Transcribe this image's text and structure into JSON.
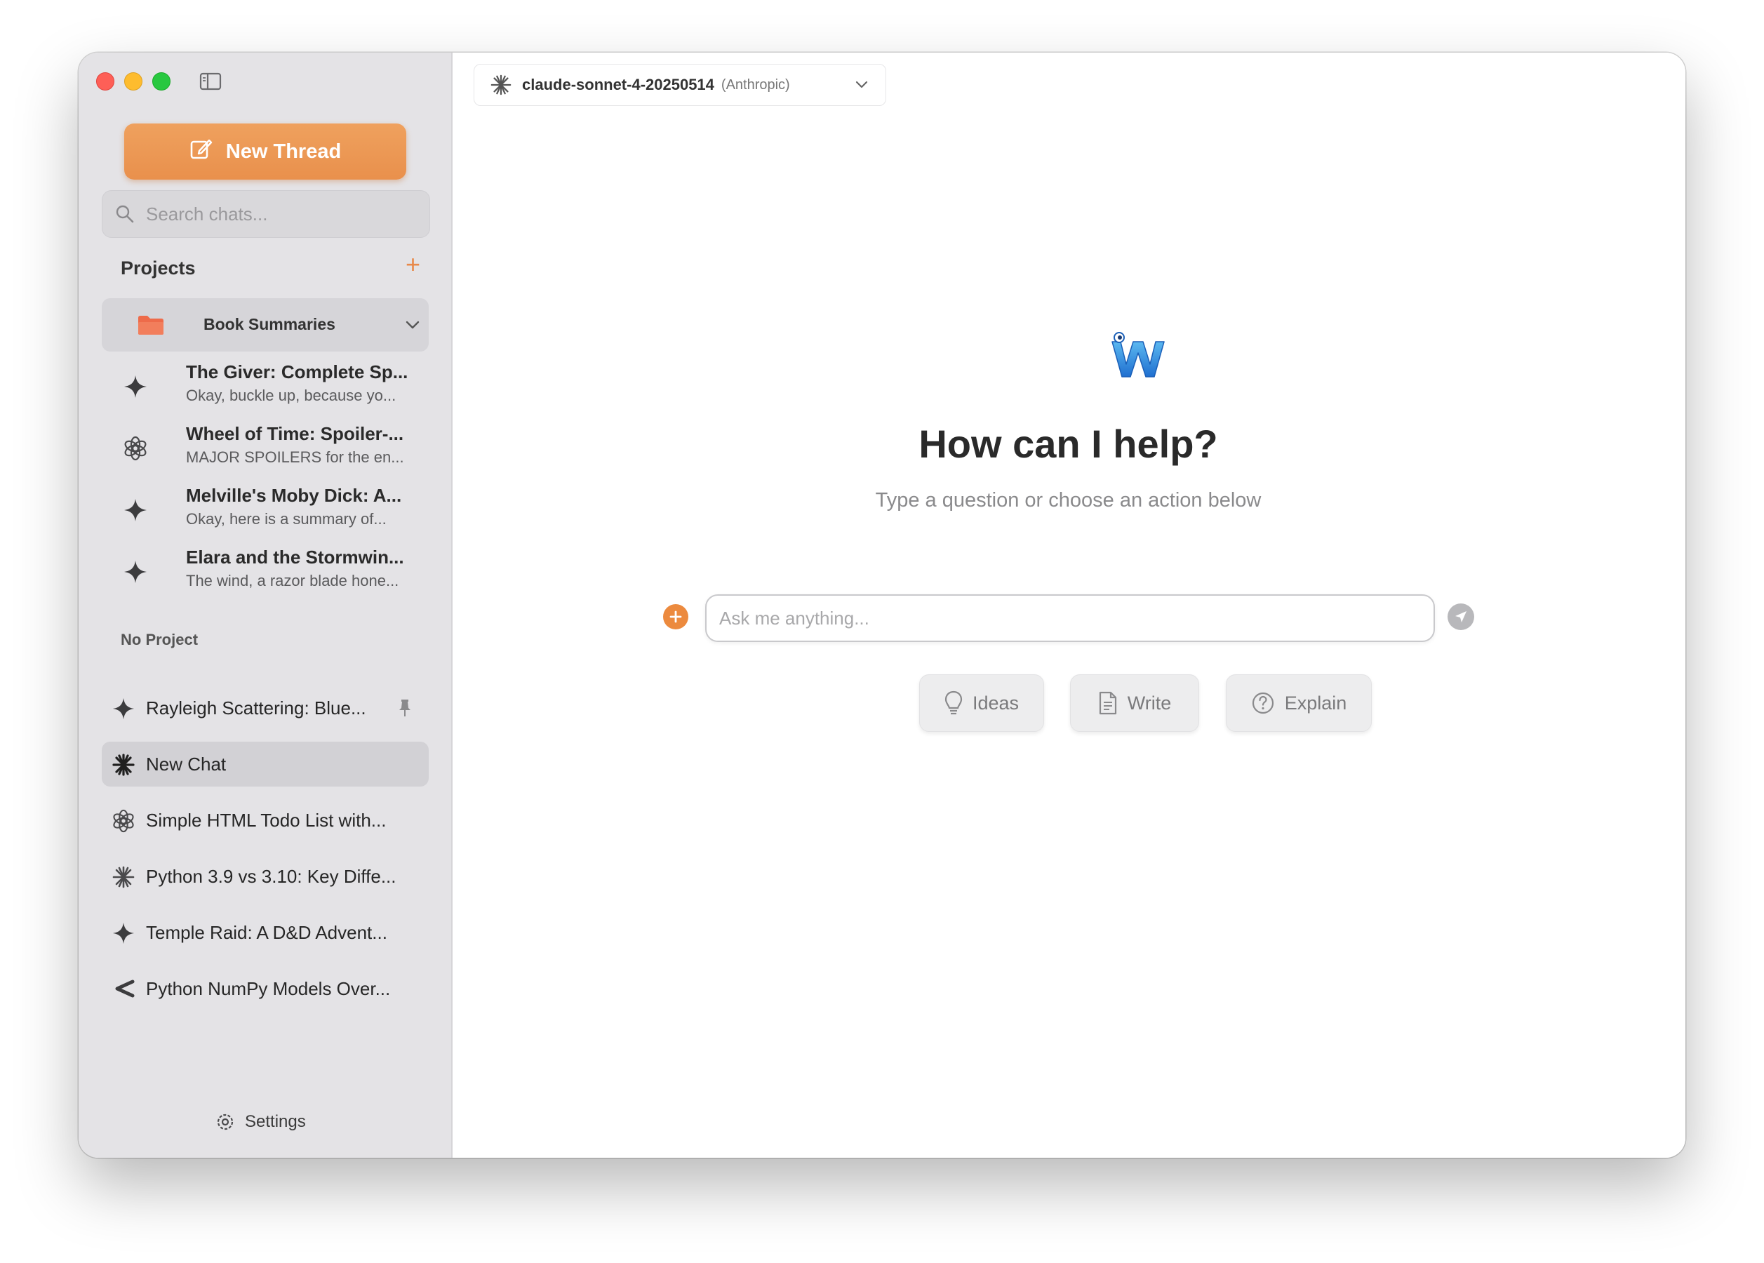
{
  "sidebar": {
    "new_thread_label": "New Thread",
    "search_placeholder": "Search chats...",
    "projects_title": "Projects",
    "projects_add": "+",
    "project_folder": {
      "name": "Book Summaries",
      "chats": [
        {
          "icon": "gemini-sparkle-icon",
          "title": "The Giver: Complete Sp...",
          "preview": "Okay, buckle up, because yo..."
        },
        {
          "icon": "openai-icon",
          "title": "Wheel of Time: Spoiler-...",
          "preview": "MAJOR SPOILERS for the en..."
        },
        {
          "icon": "gemini-sparkle-icon",
          "title": "Melville's Moby Dick: A...",
          "preview": "Okay, here is a summary of..."
        },
        {
          "icon": "gemini-sparkle-icon",
          "title": "Elara and the Stormwin...",
          "preview": "The wind, a razor blade hone..."
        }
      ]
    },
    "no_project_title": "No Project",
    "chats": [
      {
        "icon": "gemini-sparkle-icon",
        "label": "Rayleigh Scattering: Blue...",
        "pinned": true
      },
      {
        "icon": "anthropic-asterisk-icon",
        "label": "New Chat",
        "selected": true
      },
      {
        "icon": "openai-icon",
        "label": "Simple HTML Todo List with..."
      },
      {
        "icon": "anthropic-asterisk-icon",
        "label": "Python 3.9 vs 3.10: Key Diffe..."
      },
      {
        "icon": "gemini-sparkle-icon",
        "label": "Temple Raid: A D&D Advent..."
      },
      {
        "icon": "cohere-icon",
        "label": "Python NumPy Models Over..."
      }
    ],
    "settings_label": "Settings"
  },
  "main": {
    "model_name": "claude-sonnet-4-20250514",
    "model_provider": "(Anthropic)",
    "hero_title": "How can I help?",
    "hero_subtitle": "Type a question or choose an action below",
    "input_placeholder": "Ask me anything...",
    "actions": [
      {
        "icon": "lightbulb-icon",
        "label": "Ideas"
      },
      {
        "icon": "document-icon",
        "label": "Write"
      },
      {
        "icon": "question-circle-icon",
        "label": "Explain"
      }
    ]
  },
  "colors": {
    "accent": "#e9904c",
    "sidebar_bg": "#e4e3e6",
    "selected_bg": "#d2d1d5"
  }
}
